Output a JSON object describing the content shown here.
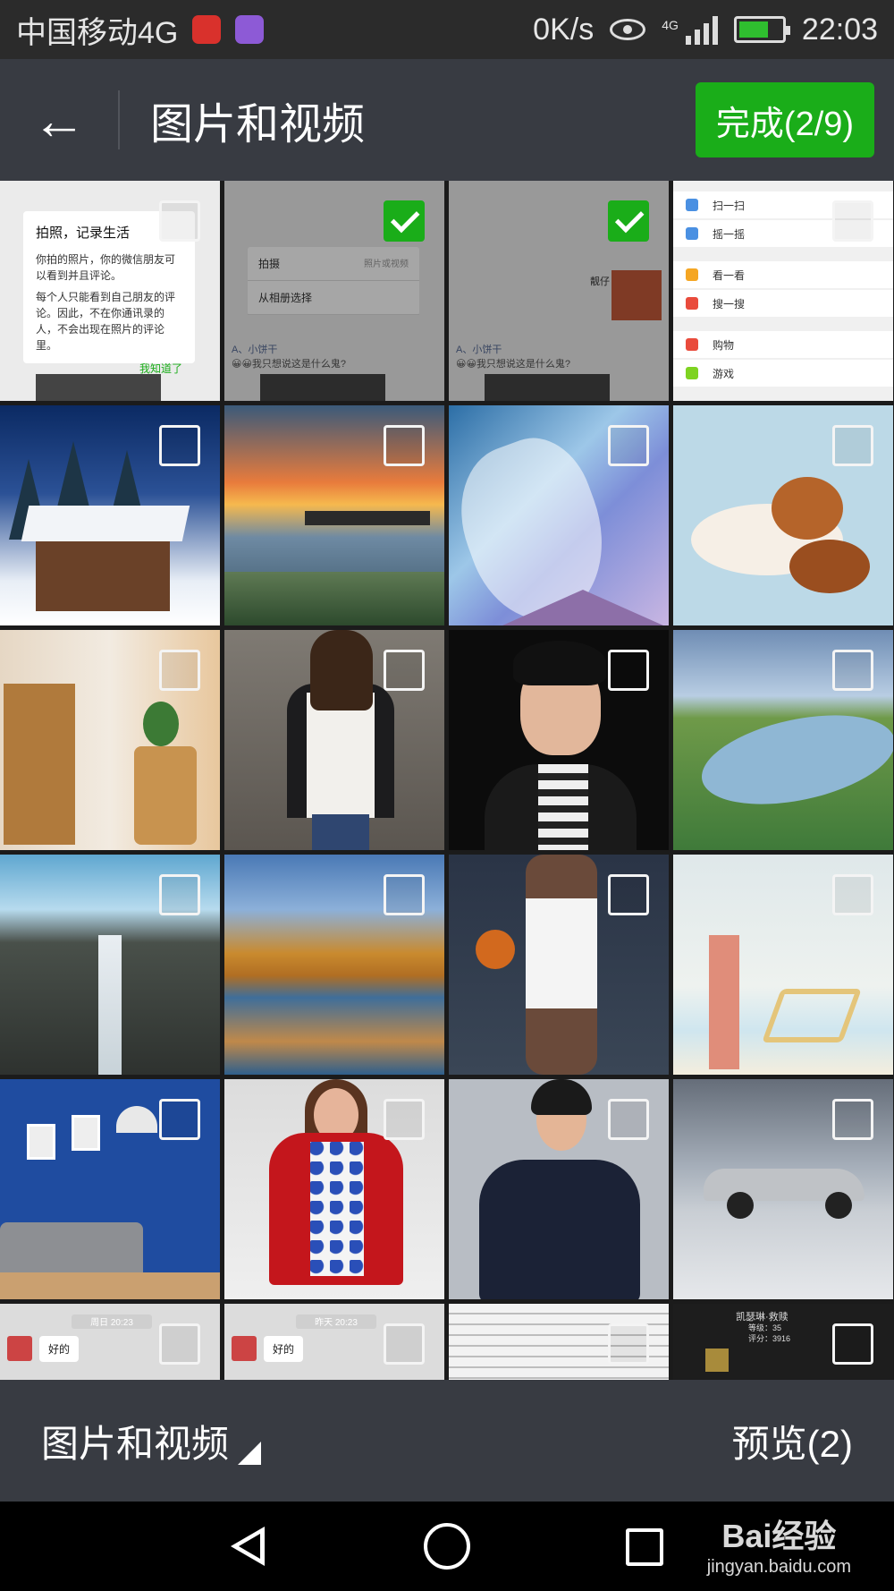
{
  "status_bar": {
    "carrier": "中国移动4G",
    "net_speed": "0K/s",
    "network_type": "4G",
    "time": "22:03",
    "app_icons": [
      "netease-music-icon",
      "gallery-icon"
    ]
  },
  "header": {
    "title": "图片和视频",
    "done_label": "完成(2/9)"
  },
  "grid": {
    "tiles": [
      {
        "kind": "screenshot-tip",
        "selected": false,
        "dialog_title": "拍照，记录生活",
        "dialog_text1": "你拍的照片，你的微信朋友可以看到并且评论。",
        "dialog_text2": "每个人只能看到自己朋友的评论。因此，不在你通讯录的人，不会出现在照片的评论里。",
        "dialog_ok": "我知道了"
      },
      {
        "kind": "screenshot-sheet",
        "selected": true,
        "sheet_item1": "拍摄",
        "sheet_item1_hint": "照片或视频",
        "sheet_item2": "从相册选择",
        "comment_name": "A、小饼干",
        "comment_text": "😀😀我只想说这是什么鬼?"
      },
      {
        "kind": "screenshot-moment",
        "selected": true,
        "nick": "靓仔",
        "comment_name": "A、小饼干",
        "comment_text": "😀😀我只想说这是什么鬼?"
      },
      {
        "kind": "screenshot-menu",
        "selected": false,
        "items": [
          "扫一扫",
          "摇一摇",
          "看一看",
          "搜一搜",
          "购物",
          "游戏"
        ]
      },
      {
        "kind": "snow-cabin",
        "selected": false
      },
      {
        "kind": "sunset-sea",
        "selected": false
      },
      {
        "kind": "ice-wave-surfer",
        "selected": false
      },
      {
        "kind": "puppies",
        "selected": false
      },
      {
        "kind": "room-interior",
        "selected": false
      },
      {
        "kind": "woman-white-sweater",
        "selected": false
      },
      {
        "kind": "young-man-portrait",
        "selected": false
      },
      {
        "kind": "river-landscape",
        "selected": false
      },
      {
        "kind": "waterfall",
        "selected": false
      },
      {
        "kind": "autumn-lake",
        "selected": false
      },
      {
        "kind": "basketball-player",
        "selected": false
      },
      {
        "kind": "illustration-beach-chair",
        "selected": false
      },
      {
        "kind": "living-room-blue",
        "selected": false
      },
      {
        "kind": "woman-red-coat",
        "selected": false
      },
      {
        "kind": "woman-navy-dress",
        "selected": false
      },
      {
        "kind": "vintage-car",
        "selected": false
      },
      {
        "kind": "chat-shot",
        "selected": false,
        "time": "周日 20:23",
        "bubble": "好的"
      },
      {
        "kind": "chat-shot",
        "selected": false,
        "time": "昨天 20:23",
        "bubble": "好的"
      },
      {
        "kind": "document-shot",
        "selected": false
      },
      {
        "kind": "game-shot",
        "selected": false,
        "title": "凯瑟琳·救赎",
        "score_label": "等级：35",
        "score_value": "评分：3916"
      }
    ]
  },
  "footer": {
    "album_label": "图片和视频",
    "preview_label": "预览(2)"
  },
  "navbar": {
    "watermark_brand": "Bai经验",
    "watermark_url": "jingyan.baidu.com"
  },
  "colors": {
    "accent_green": "#1aad19",
    "bar_bg": "#383b42"
  }
}
